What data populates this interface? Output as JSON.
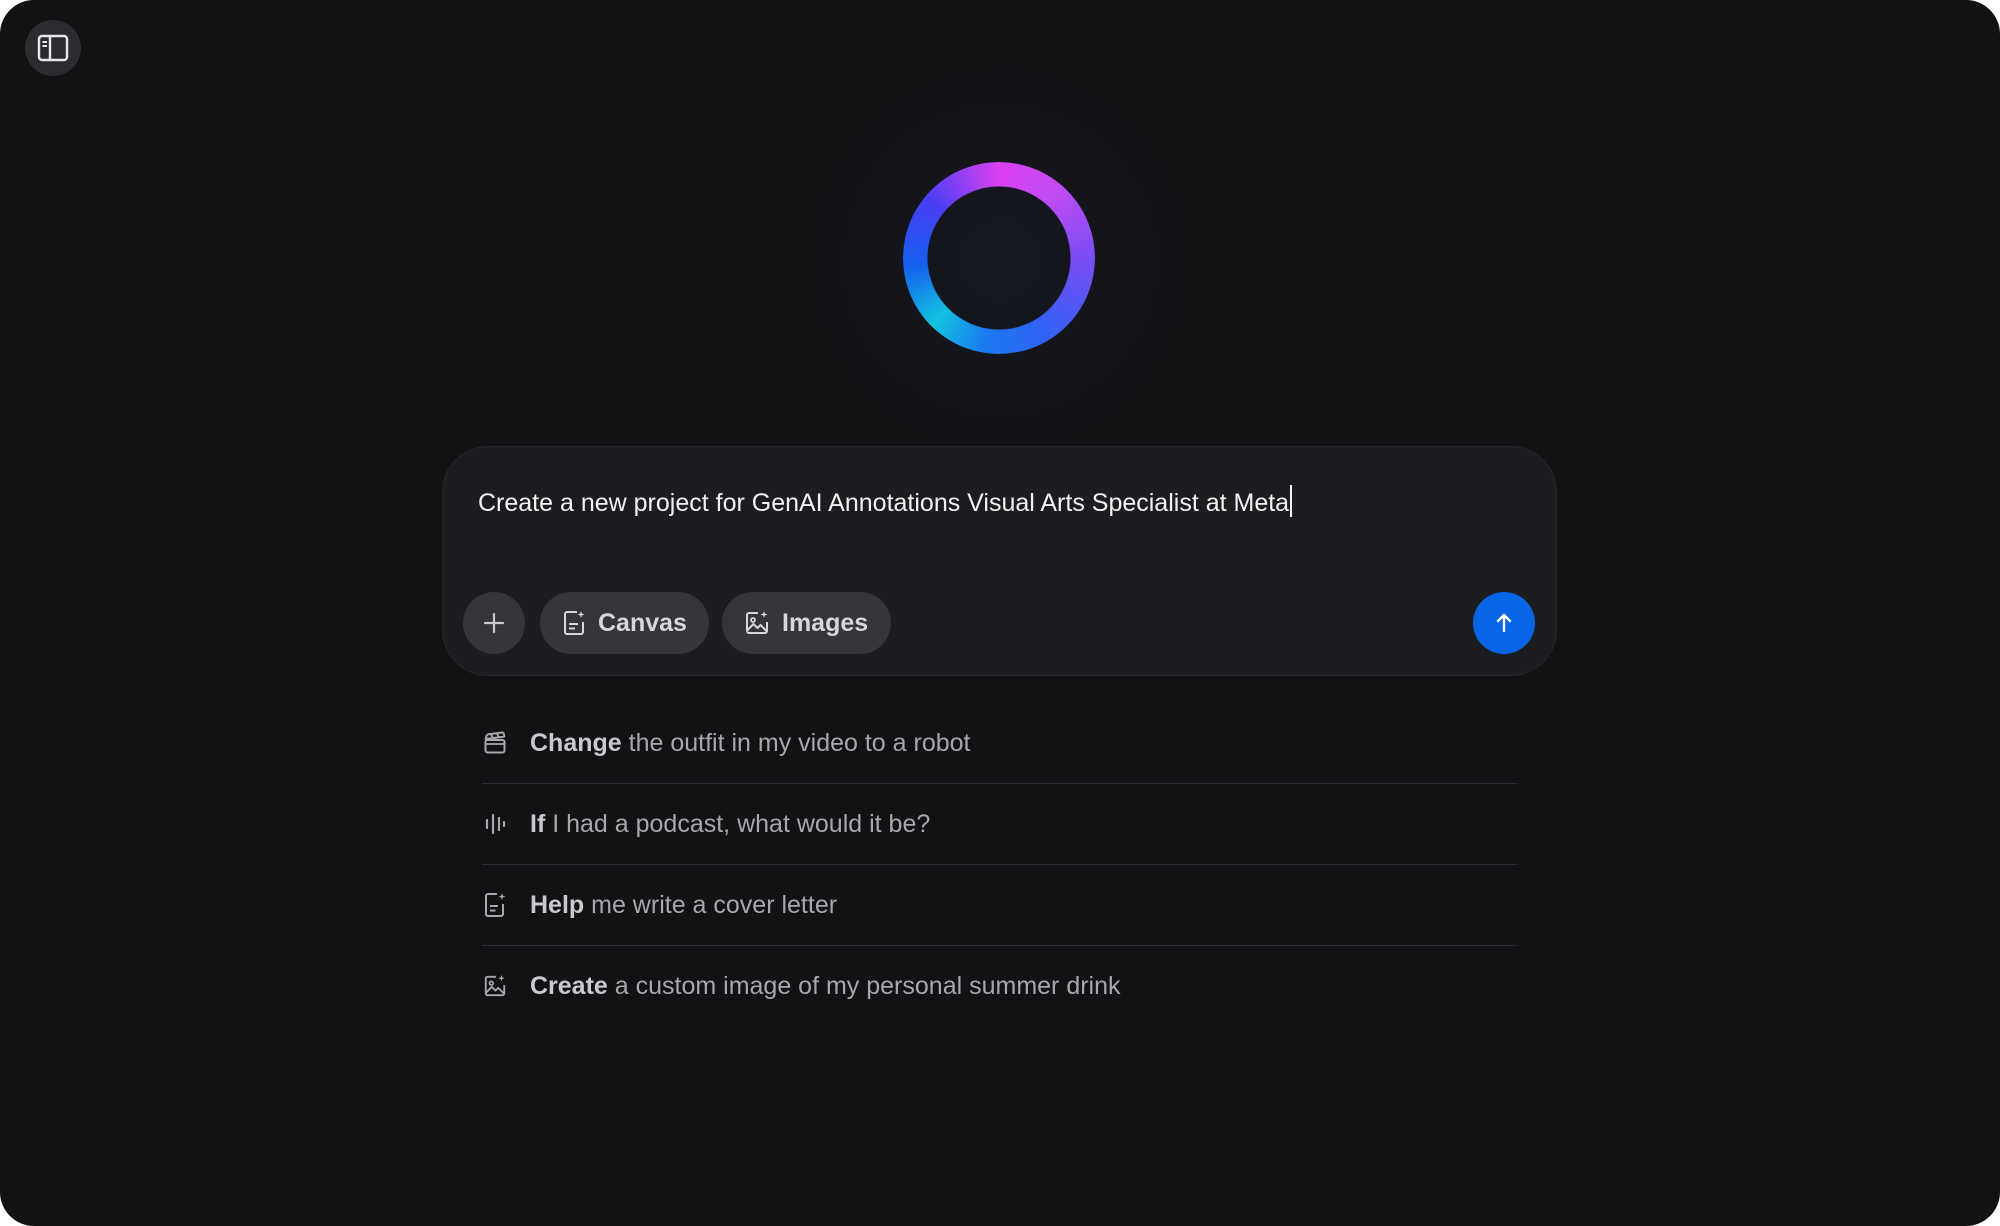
{
  "composer": {
    "input_value": "Create a new project for GenAI Annotations Visual Arts Specialist at Meta",
    "tools": [
      {
        "label": "Canvas",
        "icon": "canvas-icon"
      },
      {
        "label": "Images",
        "icon": "image-icon"
      }
    ],
    "add_icon": "plus-icon",
    "send_icon": "arrow-up-icon"
  },
  "sidebar_toggle_icon": "sidebar-panel-icon",
  "suggestions": [
    {
      "strong": "Change",
      "rest": " the outfit in my video to a robot",
      "icon": "clapperboard-icon"
    },
    {
      "strong": "If",
      "rest": " I had a podcast, what would it be?",
      "icon": "audio-waveform-icon"
    },
    {
      "strong": "Help",
      "rest": " me write a cover letter",
      "icon": "document-sparkle-icon"
    },
    {
      "strong": "Create",
      "rest": " a custom image of my personal summer drink",
      "icon": "image-sparkle-icon"
    }
  ],
  "colors": {
    "background": "#111214",
    "composer": "#1c1d20",
    "pill": "#34363a",
    "send": "#0866e6",
    "ring_gradient": [
      "#d940f0",
      "#7a4cf5",
      "#1a7af0",
      "#12c2e0"
    ]
  }
}
